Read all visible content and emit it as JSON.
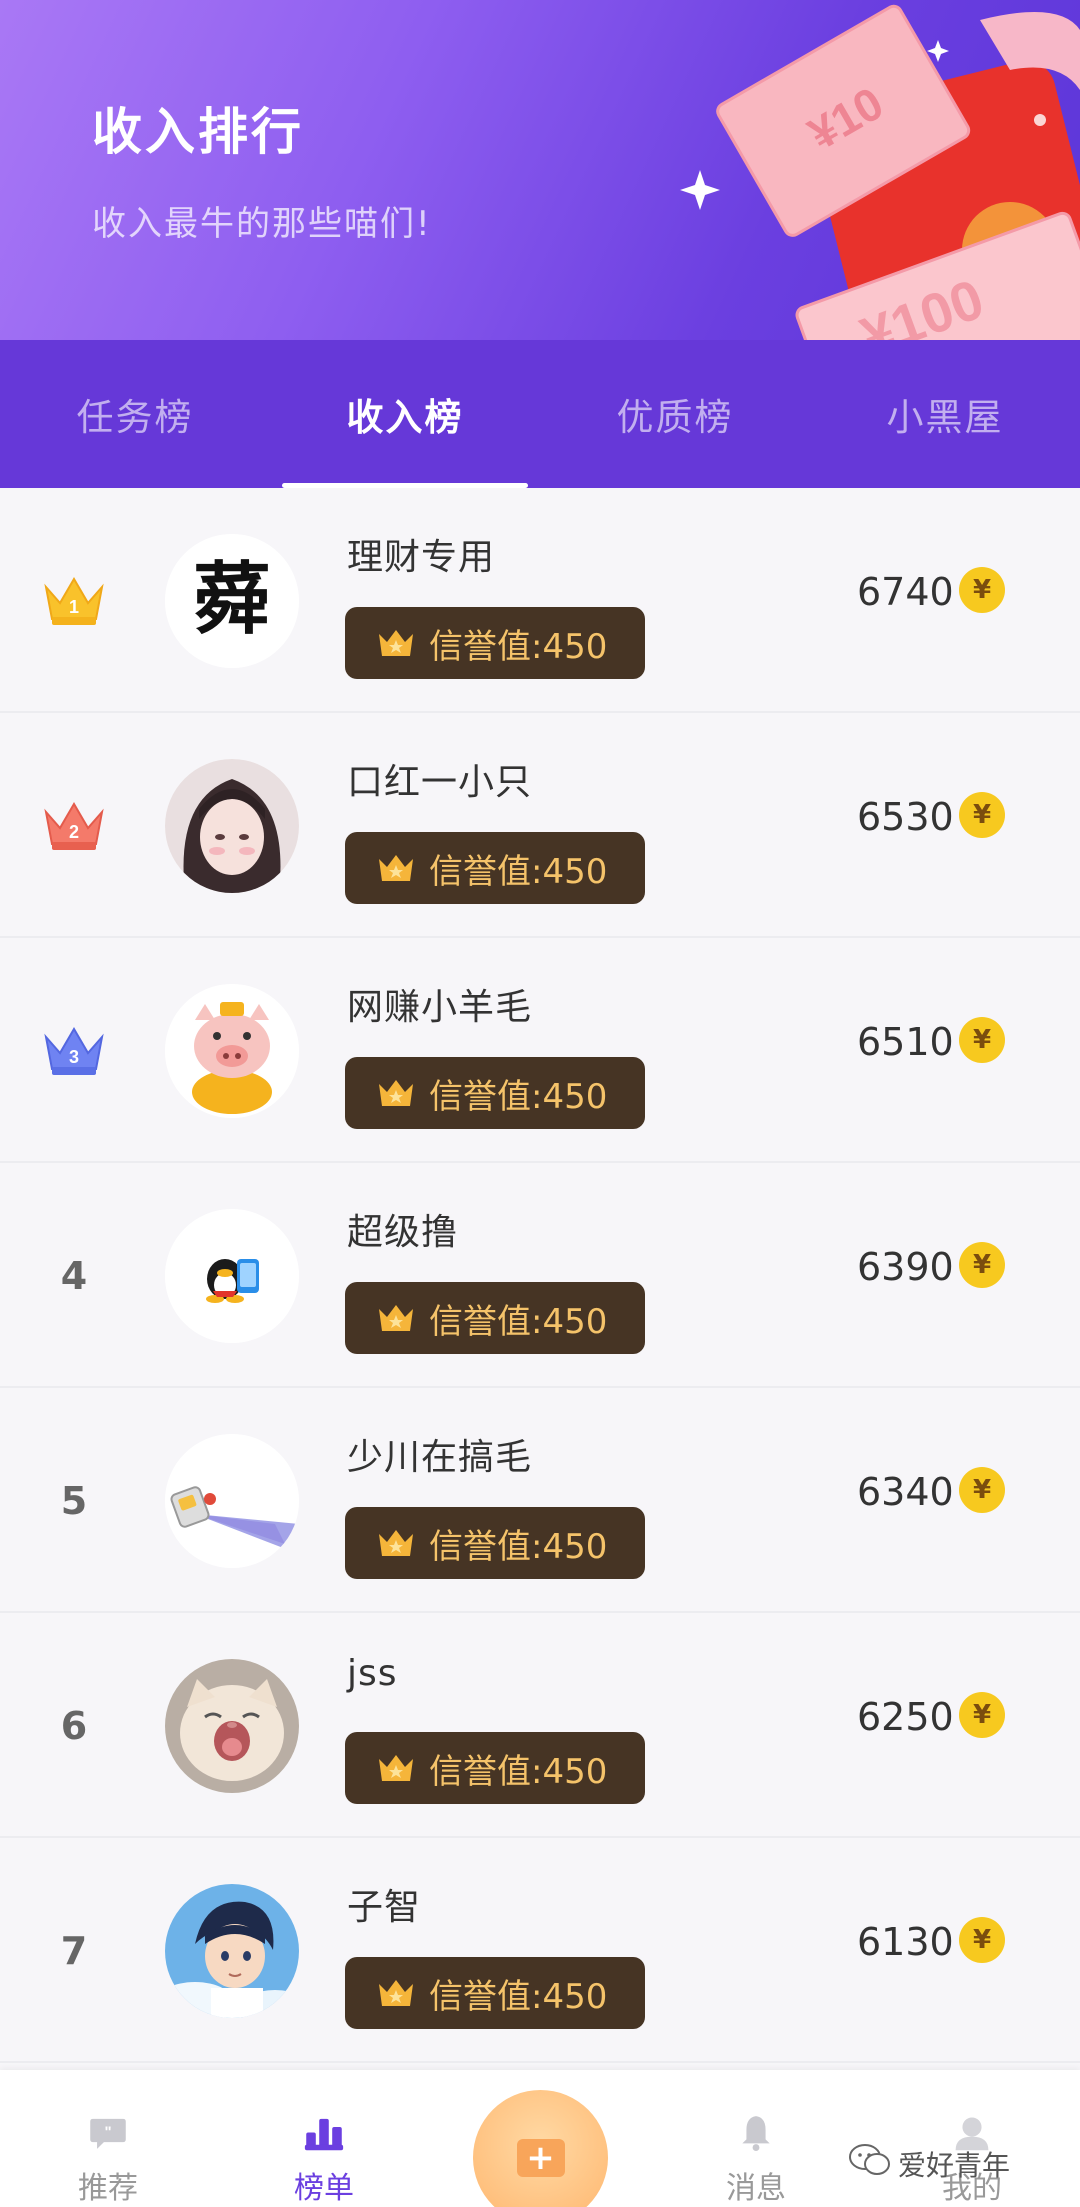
{
  "banner": {
    "title": "收入排行",
    "subtitle": "收入最牛的那些喵们!",
    "decoration": "red-envelope-money-illustration"
  },
  "tabs": [
    {
      "label": "任务榜",
      "active": false
    },
    {
      "label": "收入榜",
      "active": true
    },
    {
      "label": "优质榜",
      "active": false
    },
    {
      "label": "小黑屋",
      "active": false
    }
  ],
  "rows": [
    {
      "rank": "1",
      "rank_type": "crown-gold",
      "name": "理财专用",
      "credit": "信誉值:450",
      "amount": "6740",
      "avatar": "calligraphy-avatar"
    },
    {
      "rank": "2",
      "rank_type": "crown-red",
      "name": "口红一小只",
      "credit": "信誉值:450",
      "amount": "6530",
      "avatar": "anime-girl-avatar"
    },
    {
      "rank": "3",
      "rank_type": "crown-blue",
      "name": "网赚小羊毛",
      "credit": "信誉值:450",
      "amount": "6510",
      "avatar": "pig-avatar"
    },
    {
      "rank": "4",
      "rank_type": "number",
      "name": "超级撸",
      "credit": "信誉值:450",
      "amount": "6390",
      "avatar": "penguin-avatar"
    },
    {
      "rank": "5",
      "rank_type": "number",
      "name": "少川在搞毛",
      "credit": "信誉值:450",
      "amount": "6340",
      "avatar": "flashlight-avatar"
    },
    {
      "rank": "6",
      "rank_type": "number",
      "name": "jss",
      "credit": "信誉值:450",
      "amount": "6250",
      "avatar": "cat-avatar"
    },
    {
      "rank": "7",
      "rank_type": "number",
      "name": "子智",
      "credit": "信誉值:450",
      "amount": "6130",
      "avatar": "anime-boy-avatar"
    }
  ],
  "coin_symbol": "¥",
  "bottom_nav": [
    {
      "label": "推荐",
      "icon": "chat-icon",
      "active": false
    },
    {
      "label": "榜单",
      "icon": "ranking-icon",
      "active": true
    },
    {
      "label": "",
      "icon": "add-icon",
      "active": false
    },
    {
      "label": "消息",
      "icon": "bell-icon",
      "active": false
    },
    {
      "label": "我的",
      "icon": "profile-icon",
      "active": false
    }
  ],
  "watermark": "爱好青年",
  "colors": {
    "accent": "#6638d8",
    "badge_bg": "#463424",
    "badge_text": "#f5c36a",
    "coin": "#f7c91f"
  }
}
